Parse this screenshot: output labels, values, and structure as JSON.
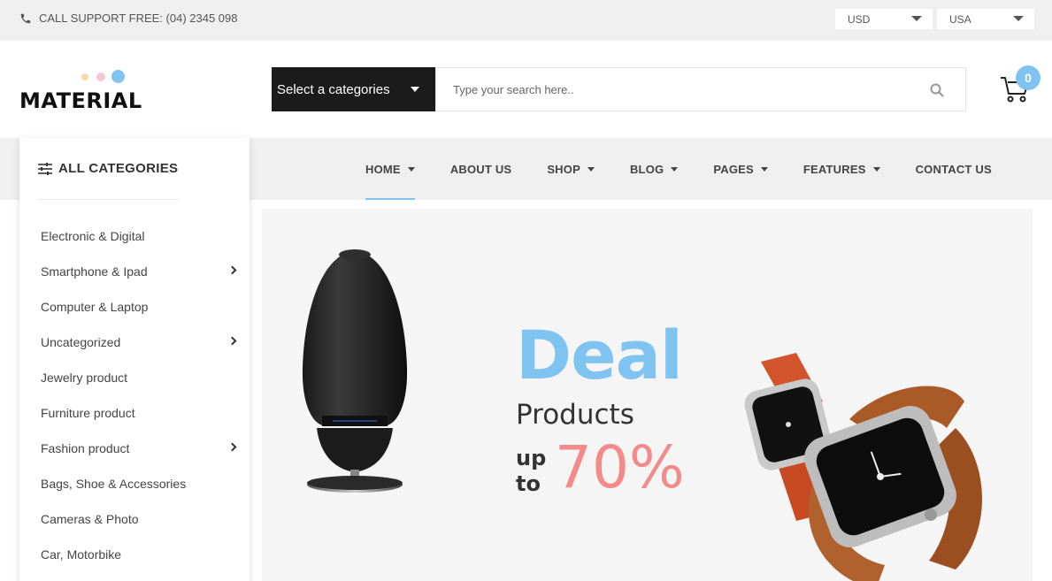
{
  "topbar": {
    "support_text": "CALL SUPPORT FREE: (04) 2345 098",
    "currency": "USD",
    "country": "USA"
  },
  "header": {
    "logo_text": "MATERIAL",
    "logo_dot_colors": [
      "#f9d9a8",
      "#f4c6d6",
      "#7fc3f0"
    ],
    "category_select": "Select a categories",
    "search_placeholder": "Type your search here..",
    "cart_count": "0"
  },
  "nav": {
    "items": [
      {
        "label": "HOME",
        "has_dropdown": true,
        "active": true
      },
      {
        "label": "ABOUT US",
        "has_dropdown": false
      },
      {
        "label": "SHOP",
        "has_dropdown": true
      },
      {
        "label": "BLOG",
        "has_dropdown": true
      },
      {
        "label": "PAGES",
        "has_dropdown": true
      },
      {
        "label": "FEATURES",
        "has_dropdown": true
      },
      {
        "label": "CONTACT US",
        "has_dropdown": false
      }
    ]
  },
  "sidebar": {
    "title": "ALL CATEGORIES",
    "items": [
      {
        "label": "Electronic & Digital",
        "has_sub": false
      },
      {
        "label": "Smartphone & Ipad",
        "has_sub": true
      },
      {
        "label": "Computer & Laptop",
        "has_sub": false
      },
      {
        "label": "Uncategorized",
        "has_sub": true
      },
      {
        "label": "Jewelry product",
        "has_sub": false
      },
      {
        "label": "Furniture product",
        "has_sub": false
      },
      {
        "label": "Fashion product",
        "has_sub": true
      },
      {
        "label": "Bags, Shoe & Accessories",
        "has_sub": false
      },
      {
        "label": "Cameras & Photo",
        "has_sub": false
      },
      {
        "label": "Car, Motorbike",
        "has_sub": false
      }
    ]
  },
  "banner": {
    "headline": "Deal",
    "subhead": "Products",
    "up_label": "up",
    "to_label": "to",
    "discount": "70%",
    "colors": {
      "accent": "#7fc3f0",
      "discount": "#f48b8b",
      "text": "#333333"
    }
  }
}
